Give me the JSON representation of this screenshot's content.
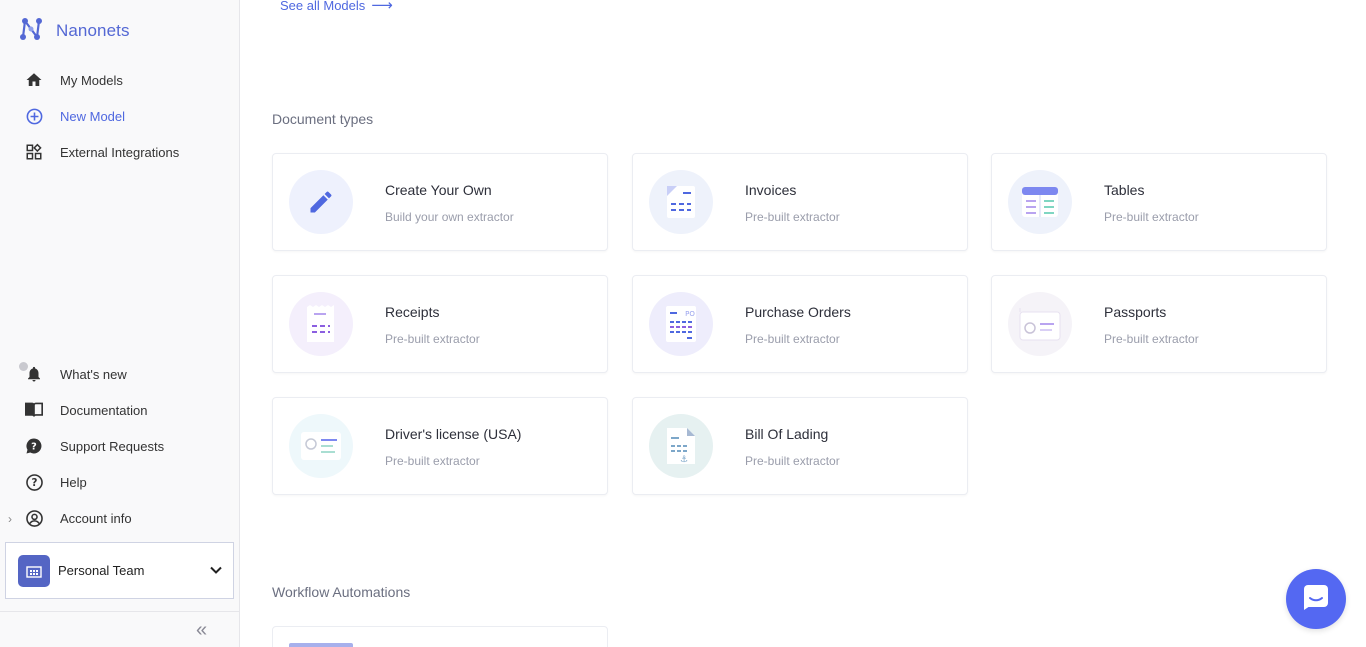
{
  "brand": {
    "name": "Nanonets"
  },
  "nav": {
    "top": [
      {
        "label": "My Models",
        "icon": "home-icon"
      },
      {
        "label": "New Model",
        "icon": "plus-circle-icon",
        "active": true
      },
      {
        "label": "External Integrations",
        "icon": "grid-icon"
      }
    ],
    "bottom": [
      {
        "label": "What's new",
        "icon": "bell-icon"
      },
      {
        "label": "Documentation",
        "icon": "book-icon"
      },
      {
        "label": "Support Requests",
        "icon": "chat-question-icon"
      },
      {
        "label": "Help",
        "icon": "help-circle-icon"
      },
      {
        "label": "Account info",
        "icon": "account-icon"
      }
    ]
  },
  "team": {
    "name": "Personal Team"
  },
  "main": {
    "see_all": "See all Models",
    "document_types_title": "Document types",
    "workflow_title": "Workflow Automations",
    "cards": [
      {
        "title": "Create Your Own",
        "subtitle": "Build your own extractor",
        "icon": "pencil-icon"
      },
      {
        "title": "Invoices",
        "subtitle": "Pre-built extractor",
        "icon": "invoice-icon"
      },
      {
        "title": "Tables",
        "subtitle": "Pre-built extractor",
        "icon": "table-icon"
      },
      {
        "title": "Receipts",
        "subtitle": "Pre-built extractor",
        "icon": "receipt-icon"
      },
      {
        "title": "Purchase Orders",
        "subtitle": "Pre-built extractor",
        "icon": "purchase-order-icon",
        "badge": "PO"
      },
      {
        "title": "Passports",
        "subtitle": "Pre-built extractor",
        "icon": "passport-icon"
      },
      {
        "title": "Driver's license (USA)",
        "subtitle": "Pre-built extractor",
        "icon": "id-card-icon"
      },
      {
        "title": "Bill Of Lading",
        "subtitle": "Pre-built extractor",
        "icon": "bill-of-lading-icon"
      }
    ]
  },
  "colors": {
    "accent": "#4f68e0",
    "sidebar_bg": "#f9f9fa",
    "chat_button": "#5468f2"
  }
}
